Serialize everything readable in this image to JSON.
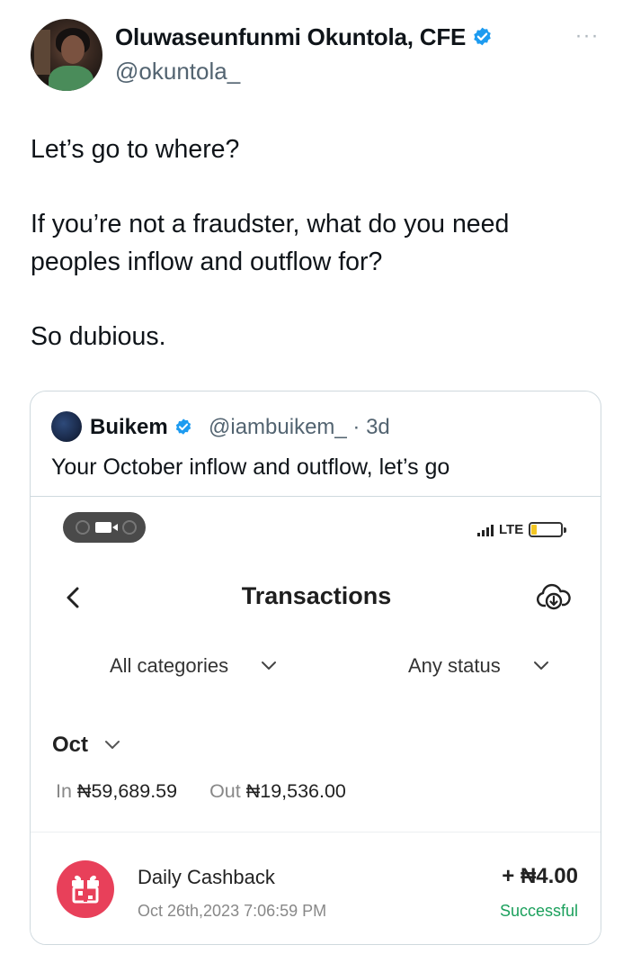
{
  "tweet": {
    "author_name": "Oluwaseunfunmi Okuntola, CFE",
    "author_handle": "@okuntola_",
    "text": "Let’s go to where?\n\nIf you’re not a fraudster, what do you need peoples inflow and outflow for?\n\nSo dubious.",
    "more_icon": "more-horizontal-icon",
    "verified_color": "#1d9bf0"
  },
  "quote": {
    "author_name": "Buikem",
    "author_handle": "@iambuikem_ · 3d",
    "text": "Your October inflow and outflow, let’s go"
  },
  "phone": {
    "status": {
      "network": "LTE",
      "battery_level": 0.2
    },
    "title": "Transactions",
    "filters": {
      "category": "All categories",
      "status": "Any status"
    },
    "month": "Oct",
    "summary": {
      "in_label": "In",
      "in_amount": "₦59,689.59",
      "out_label": "Out",
      "out_amount": "₦19,536.00"
    },
    "transactions": [
      {
        "name": "Daily Cashback",
        "date": "Oct 26th,2023 7:06:59 PM",
        "amount": "+ ₦4.00",
        "status": "Successful",
        "icon": "gift-icon",
        "icon_color": "#e8405a",
        "status_color": "#1ba05c"
      }
    ]
  }
}
